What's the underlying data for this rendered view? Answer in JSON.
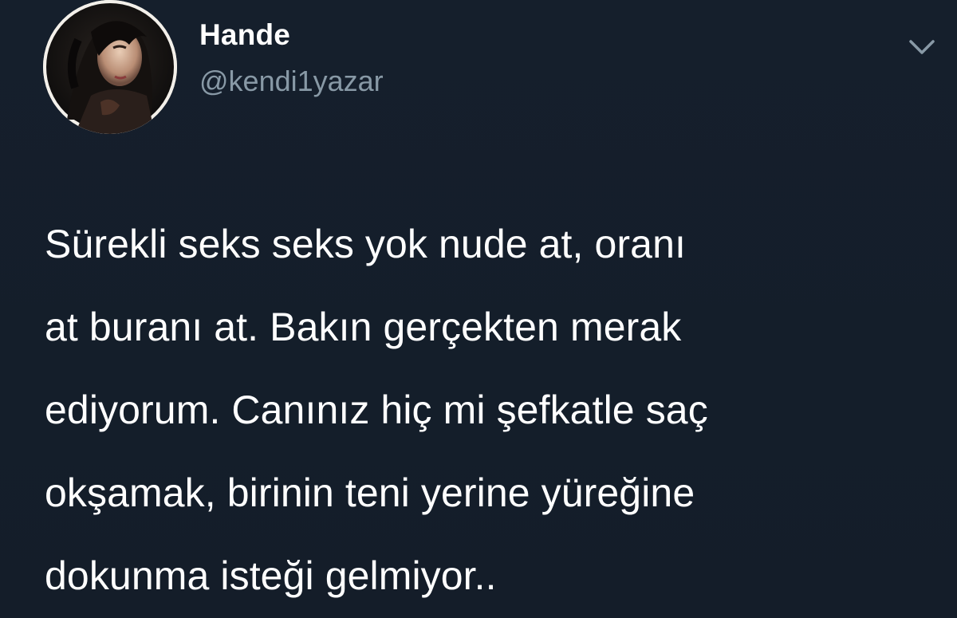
{
  "tweet": {
    "author": {
      "display_name": "Hande",
      "handle": "@kendi1yazar",
      "avatar_icon": "profile-photo-avatar"
    },
    "menu_icon": "chevron-down-icon",
    "text_lines": [
      "Sürekli seks seks yok nude at, oranı",
      "at buranı at. Bakın gerçekten merak",
      "ediyorum. Canınız hiç mi şefkatle saç",
      "okşamak, birinin teni yerine yüreğine",
      "dokunma isteği gelmiyor.."
    ]
  },
  "colors": {
    "background": "#15202b",
    "primary_text": "#ffffff",
    "secondary_text": "#8899a6",
    "avatar_border": "#f1eee8"
  }
}
